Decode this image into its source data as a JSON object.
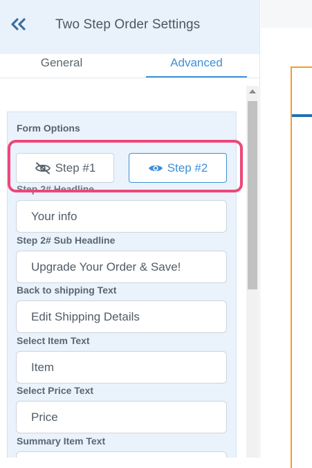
{
  "header": {
    "title": "Two Step Order Settings",
    "back_icon": "double-chevron-left-icon"
  },
  "tabs": [
    {
      "label": "General",
      "active": false
    },
    {
      "label": "Advanced",
      "active": true
    }
  ],
  "section": {
    "title": "Form Options",
    "steps": [
      {
        "label": "Step #1",
        "icon": "eye-slash-icon",
        "selected": false
      },
      {
        "label": "Step #2",
        "icon": "eye-icon",
        "selected": true
      }
    ],
    "fields": [
      {
        "label": "Step 2# Headline",
        "value": "Your info"
      },
      {
        "label": "Step 2# Sub Headline",
        "value": "Upgrade Your Order & Save!"
      },
      {
        "label": "Back to shipping Text",
        "value": "Edit Shipping Details"
      },
      {
        "label": "Select Item Text",
        "value": "Item"
      },
      {
        "label": "Select Price Text",
        "value": "Price"
      },
      {
        "label": "Summary Item Text",
        "value": ""
      }
    ]
  },
  "colors": {
    "accent": "#3d8fd8",
    "highlight": "#ef4678",
    "header_bg": "#e9f2fb",
    "section_bg": "#eaf3fc",
    "preview_border": "#f39c2f",
    "preview_bar": "#1f6fb5"
  }
}
